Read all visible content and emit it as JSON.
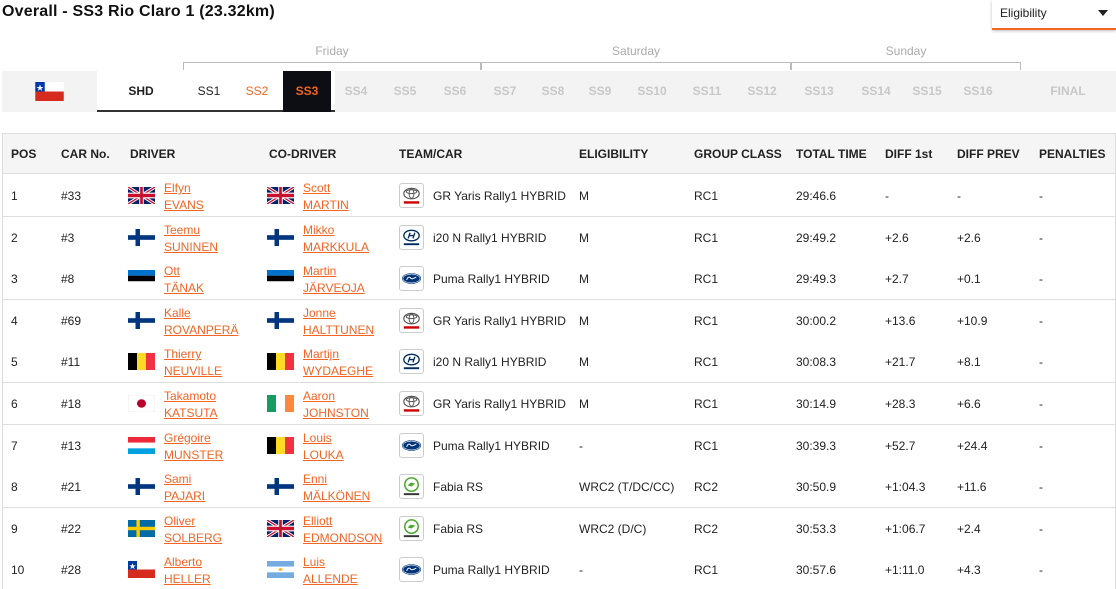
{
  "title": "Overall - SS3 Rio Claro 1 (23.32km)",
  "eligibility_select": {
    "value": "Eligibility"
  },
  "days": [
    "Friday",
    "Saturday",
    "Sunday"
  ],
  "stages": [
    {
      "label": "SHD",
      "state": "shd"
    },
    {
      "label": "SS1",
      "state": "done"
    },
    {
      "label": "SS2",
      "state": "orange"
    },
    {
      "label": "SS3",
      "state": "active"
    },
    {
      "label": "SS4",
      "state": "future"
    },
    {
      "label": "SS5",
      "state": "future"
    },
    {
      "label": "SS6",
      "state": "future"
    },
    {
      "label": "SS7",
      "state": "future"
    },
    {
      "label": "SS8",
      "state": "future"
    },
    {
      "label": "SS9",
      "state": "future"
    },
    {
      "label": "SS10",
      "state": "future"
    },
    {
      "label": "SS11",
      "state": "future"
    },
    {
      "label": "SS12",
      "state": "future"
    },
    {
      "label": "SS13",
      "state": "future"
    },
    {
      "label": "SS14",
      "state": "future"
    },
    {
      "label": "SS15",
      "state": "future"
    },
    {
      "label": "SS16",
      "state": "future"
    },
    {
      "label": "FINAL",
      "state": "future"
    }
  ],
  "colors": {
    "accent": "#f26522",
    "active_bg": "#0d0d14",
    "future_text": "#c8c8c8"
  },
  "columns": [
    "POS",
    "CAR No.",
    "DRIVER",
    "CO-DRIVER",
    "TEAM/CAR",
    "ELIGIBILITY",
    "GROUP CLASS",
    "TOTAL TIME",
    "DIFF 1st",
    "DIFF PREV",
    "PENALTIES"
  ],
  "rows": [
    {
      "pos": "1",
      "car": "#33",
      "driver_first": "Elfyn",
      "driver_last": "EVANS",
      "driver_flag": "gb",
      "codriver_first": "Scott",
      "codriver_last": "MARTIN",
      "codriver_flag": "gb",
      "logo": "toyota",
      "team": "GR Yaris Rally1 HYBRID",
      "elig": "M",
      "group": "RC1",
      "time": "29:46.6",
      "diff1": "-",
      "diffprev": "-",
      "pen": "-"
    },
    {
      "pos": "2",
      "car": "#3",
      "driver_first": "Teemu",
      "driver_last": "SUNINEN",
      "driver_flag": "fi",
      "codriver_first": "Mikko",
      "codriver_last": "MARKKULA",
      "codriver_flag": "fi",
      "logo": "hyundai",
      "team": "i20 N Rally1 HYBRID",
      "elig": "M",
      "group": "RC1",
      "time": "29:49.2",
      "diff1": "+2.6",
      "diffprev": "+2.6",
      "pen": "-"
    },
    {
      "pos": "3",
      "car": "#8",
      "driver_first": "Ott",
      "driver_last": "TÄNAK",
      "driver_flag": "ee",
      "codriver_first": "Martin",
      "codriver_last": "JÄRVEOJA",
      "codriver_flag": "ee",
      "logo": "ford",
      "team": "Puma Rally1 HYBRID",
      "elig": "M",
      "group": "RC1",
      "time": "29:49.3",
      "diff1": "+2.7",
      "diffprev": "+0.1",
      "pen": "-"
    },
    {
      "pos": "4",
      "car": "#69",
      "driver_first": "Kalle",
      "driver_last": "ROVANPERÄ",
      "driver_flag": "fi",
      "codriver_first": "Jonne",
      "codriver_last": "HALTTUNEN",
      "codriver_flag": "fi",
      "logo": "toyota",
      "team": "GR Yaris Rally1 HYBRID",
      "elig": "M",
      "group": "RC1",
      "time": "30:00.2",
      "diff1": "+13.6",
      "diffprev": "+10.9",
      "pen": "-"
    },
    {
      "pos": "5",
      "car": "#11",
      "driver_first": "Thierry",
      "driver_last": "NEUVILLE",
      "driver_flag": "be",
      "codriver_first": "Martijn",
      "codriver_last": "WYDAEGHE",
      "codriver_flag": "be",
      "logo": "hyundai",
      "team": "i20 N Rally1 HYBRID",
      "elig": "M",
      "group": "RC1",
      "time": "30:08.3",
      "diff1": "+21.7",
      "diffprev": "+8.1",
      "pen": "-"
    },
    {
      "pos": "6",
      "car": "#18",
      "driver_first": "Takamoto",
      "driver_last": "KATSUTA",
      "driver_flag": "jp",
      "codriver_first": "Aaron",
      "codriver_last": "JOHNSTON",
      "codriver_flag": "ie",
      "logo": "toyota",
      "team": "GR Yaris Rally1 HYBRID",
      "elig": "M",
      "group": "RC1",
      "time": "30:14.9",
      "diff1": "+28.3",
      "diffprev": "+6.6",
      "pen": "-"
    },
    {
      "pos": "7",
      "car": "#13",
      "driver_first": "Grégoire",
      "driver_last": "MUNSTER",
      "driver_flag": "lu",
      "codriver_first": "Louis",
      "codriver_last": "LOUKA",
      "codriver_flag": "be",
      "logo": "ford",
      "team": "Puma Rally1 HYBRID",
      "elig": "-",
      "group": "RC1",
      "time": "30:39.3",
      "diff1": "+52.7",
      "diffprev": "+24.4",
      "pen": "-"
    },
    {
      "pos": "8",
      "car": "#21",
      "driver_first": "Sami",
      "driver_last": "PAJARI",
      "driver_flag": "fi",
      "codriver_first": "Enni",
      "codriver_last": "MÄLKÖNEN",
      "codriver_flag": "fi",
      "logo": "skoda",
      "team": "Fabia RS",
      "elig": "WRC2 (T/DC/CC)",
      "group": "RC2",
      "time": "30:50.9",
      "diff1": "+1:04.3",
      "diffprev": "+11.6",
      "pen": "-"
    },
    {
      "pos": "9",
      "car": "#22",
      "driver_first": "Oliver",
      "driver_last": "SOLBERG",
      "driver_flag": "se",
      "codriver_first": "Elliott",
      "codriver_last": "EDMONDSON",
      "codriver_flag": "gb",
      "logo": "skoda",
      "team": "Fabia RS",
      "elig": "WRC2 (D/C)",
      "group": "RC2",
      "time": "30:53.3",
      "diff1": "+1:06.7",
      "diffprev": "+2.4",
      "pen": "-"
    },
    {
      "pos": "10",
      "car": "#28",
      "driver_first": "Alberto",
      "driver_last": "HELLER",
      "driver_flag": "cl",
      "codriver_first": "Luis",
      "codriver_last": "ALLENDE",
      "codriver_flag": "ar",
      "logo": "ford",
      "team": "Puma Rally1 HYBRID",
      "elig": "-",
      "group": "RC1",
      "time": "30:57.6",
      "diff1": "+1:11.0",
      "diffprev": "+4.3",
      "pen": "-"
    }
  ]
}
